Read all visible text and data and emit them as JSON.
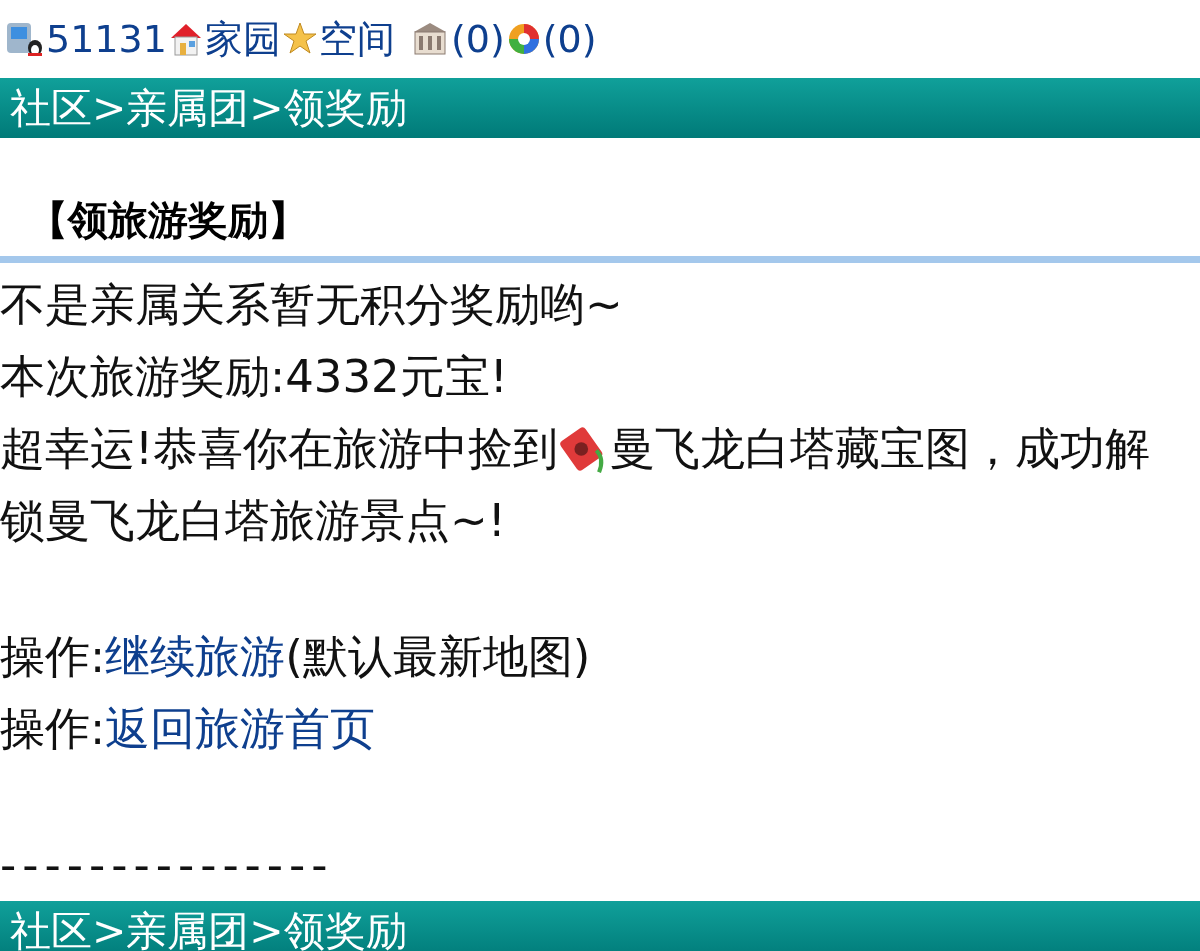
{
  "top_bar": {
    "user_id": "51131",
    "home": "家园",
    "space": "空间",
    "hall_count": "(0)",
    "photo_count": "(0)"
  },
  "breadcrumb_top": "社区>亲属团>领奖励",
  "heading": "【领旅游奖励】",
  "messages": [
    "不是亲属关系暂无积分奖励哟~",
    "本次旅游奖励:4332元宝!"
  ],
  "treasure": {
    "before": "超幸运!恭喜你在旅游中捡到",
    "after": "曼飞龙白塔藏宝图，成功解",
    "continued": "锁曼飞龙白塔旅游景点~!"
  },
  "actions": [
    {
      "label": "操作:",
      "link": "继续旅游",
      "note": "(默认最新地图)"
    },
    {
      "label": "操作:",
      "link": "返回旅游首页"
    }
  ],
  "divider": "---------------",
  "breadcrumb_bottom": "社区>亲属团>领奖励"
}
